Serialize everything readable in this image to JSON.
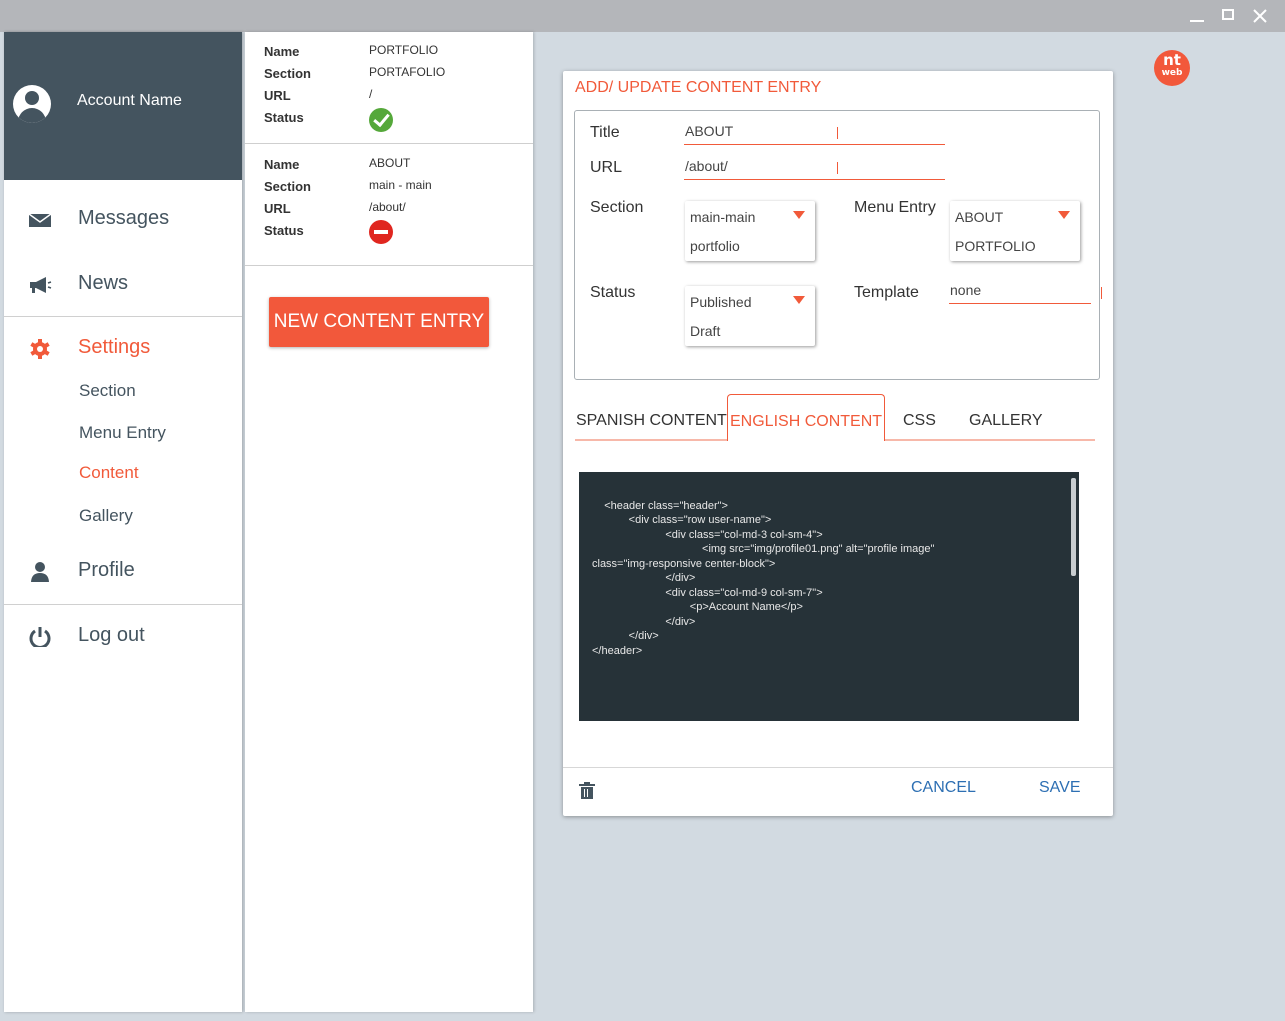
{
  "window": {
    "controls": [
      "minimize",
      "maximize",
      "close"
    ]
  },
  "brand": {
    "line1": "nt",
    "line2": "web",
    "color": "#f2583b"
  },
  "sidebar": {
    "account_name": "Account Name",
    "items": [
      {
        "label": "Messages",
        "icon": "envelope-icon"
      },
      {
        "label": "News",
        "icon": "megaphone-icon"
      },
      {
        "label": "Settings",
        "icon": "gear-icon",
        "active": true
      },
      {
        "label": "Profile",
        "icon": "person-icon"
      },
      {
        "label": "Log out",
        "icon": "power-icon"
      }
    ],
    "settings_sub": [
      "Section",
      "Menu Entry",
      "Content",
      "Gallery"
    ],
    "active_sub": "Content"
  },
  "content_list": {
    "labels": {
      "name": "Name",
      "section": "Section",
      "url": "URL",
      "status": "Status"
    },
    "entries": [
      {
        "name": "PORTFOLIO",
        "section": "PORTAFOLIO",
        "url": "/",
        "status": "published"
      },
      {
        "name": "ABOUT",
        "section": "main - main",
        "url": "/about/",
        "status": "draft"
      }
    ],
    "new_button": "NEW CONTENT ENTRY"
  },
  "dialog": {
    "title": "ADD/ UPDATE CONTENT ENTRY",
    "fields": {
      "title_label": "Title",
      "title_value": "ABOUT",
      "url_label": "URL",
      "url_value": "/about/",
      "section_label": "Section",
      "section_options": [
        "main-main",
        "portfolio"
      ],
      "menu_label": "Menu Entry",
      "menu_options": [
        "ABOUT",
        "PORTFOLIO"
      ],
      "status_label": "Status",
      "status_options": [
        "Published",
        "Draft"
      ],
      "template_label": "Template",
      "template_value": "none"
    },
    "tabs": [
      "SPANISH CONTENT",
      "ENGLISH CONTENT",
      "CSS",
      "GALLERY"
    ],
    "active_tab": "ENGLISH CONTENT",
    "code": "<header class=\"header\">\n            <div class=\"row user-name\">\n                        <div class=\"col-md-3 col-sm-4\">\n                                    <img src=\"img/profile01.png\" alt=\"profile image\"\nclass=\"img-responsive center-block\">\n                        </div>\n                        <div class=\"col-md-9 col-sm-7\">\n                                <p>Account Name</p>\n                        </div>\n            </div>\n</header>",
    "cancel": "CANCEL",
    "save": "SAVE"
  },
  "colors": {
    "accent": "#f15a3a",
    "sidebar_header": "#44545f",
    "link": "#2d6fb3",
    "code_bg": "#263238",
    "ok": "#55a83a",
    "error": "#e0261f"
  }
}
